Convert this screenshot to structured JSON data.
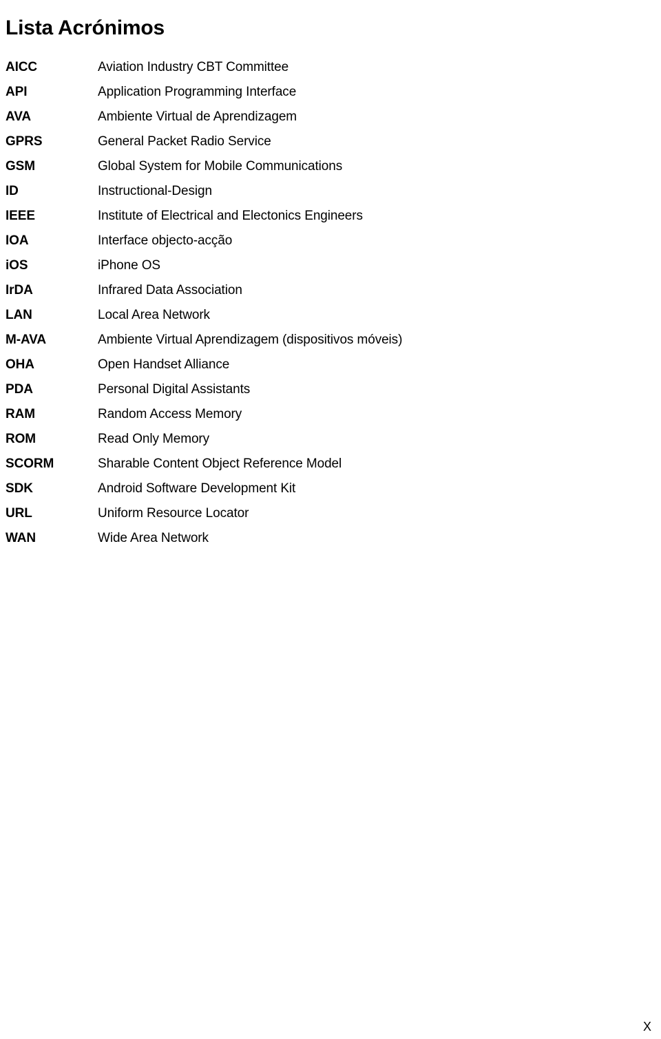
{
  "document": {
    "title": "Lista Acrónimos",
    "page_marker": "X",
    "rows": [
      {
        "term": "AICC",
        "definition": "Aviation Industry CBT Committee"
      },
      {
        "term": "API",
        "definition": "Application Programming Interface"
      },
      {
        "term": "AVA",
        "definition": "Ambiente Virtual de Aprendizagem"
      },
      {
        "term": "GPRS",
        "definition": "General Packet Radio Service"
      },
      {
        "term": "GSM",
        "definition": "Global System for Mobile Communications"
      },
      {
        "term": "ID",
        "definition": "Instructional-Design"
      },
      {
        "term": "IEEE",
        "definition": "Institute of Electrical and Electonics Engineers"
      },
      {
        "term": "IOA",
        "definition": "Interface objecto-acção"
      },
      {
        "term": "iOS",
        "definition": "iPhone OS"
      },
      {
        "term": "IrDA",
        "definition": "Infrared Data Association"
      },
      {
        "term": "LAN",
        "definition": "Local Area Network"
      },
      {
        "term": "M-AVA",
        "definition": "Ambiente Virtual Aprendizagem (dispositivos móveis)"
      },
      {
        "term": "OHA",
        "definition": "Open Handset Alliance"
      },
      {
        "term": "PDA",
        "definition": "Personal Digital Assistants"
      },
      {
        "term": "RAM",
        "definition": "Random Access Memory"
      },
      {
        "term": "ROM",
        "definition": "Read Only Memory"
      },
      {
        "term": "SCORM",
        "definition": "Sharable Content Object Reference Model"
      },
      {
        "term": "SDK",
        "definition": "Android Software Development Kit"
      },
      {
        "term": "URL",
        "definition": "Uniform Resource Locator"
      },
      {
        "term": "WAN",
        "definition": "Wide Area Network"
      }
    ]
  }
}
